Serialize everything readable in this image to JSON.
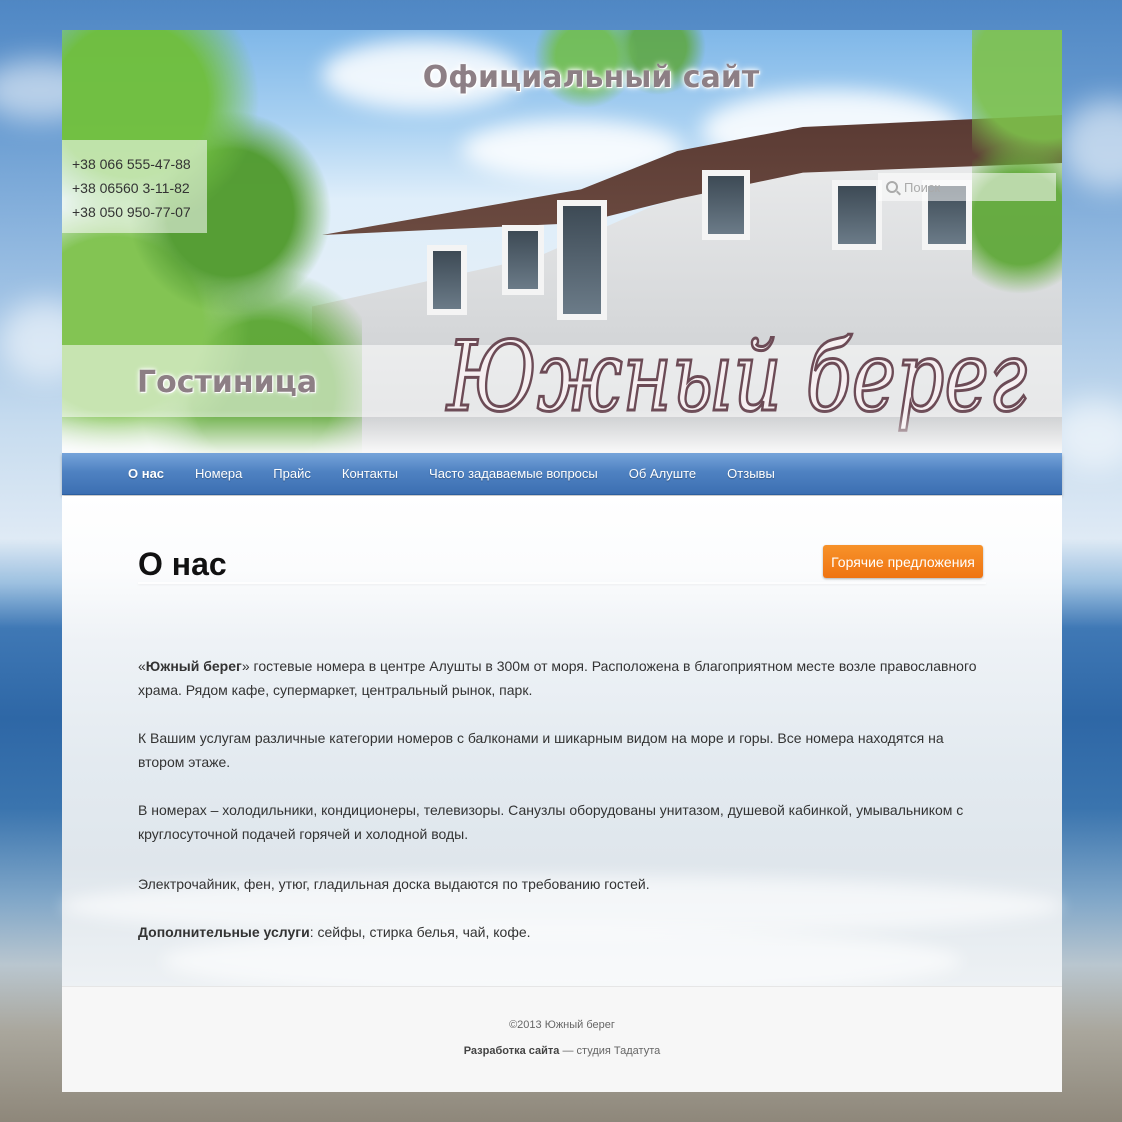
{
  "header": {
    "official_title": "Официальный сайт",
    "hotel_label": "Гостиница",
    "logo_text": "Южный берег",
    "phones": [
      "+38 066 555-47-88",
      "+38 06560 3-11-82",
      "+38 050 950-77-07"
    ],
    "search": {
      "placeholder": "Поиск"
    }
  },
  "nav": {
    "items": [
      {
        "label": "О нас",
        "active": true
      },
      {
        "label": "Номера"
      },
      {
        "label": "Прайс"
      },
      {
        "label": "Контакты"
      },
      {
        "label": "Часто задаваемые вопросы"
      },
      {
        "label": "Об Алуште"
      },
      {
        "label": "Отзывы"
      }
    ]
  },
  "main": {
    "title": "О нас",
    "hot_button": "Горячие предложения",
    "p1_open_quote": "«",
    "p1_bold": "Южный берег",
    "p1_rest": "» гостевые номера в центре Алушты в 300м от моря. Расположена в благоприятном месте возле  православного храма. Рядом кафе, супермаркет, центральный рынок, парк.",
    "p2": "К Вашим услугам  различные  категории номеров с балконами и шикарным видом на море и горы. Все номера находятся на втором этаже.",
    "p3": "В номерах – холодильники, кондиционеры, телевизоры. Санузлы оборудованы унитазом, душевой кабинкой, умывальником  с круглосуточной подачей горячей и холодной воды.",
    "p4": "Электрочайник, фен, утюг, гладильная доска выдаются по требованию гостей.",
    "p5_bold": "Дополнительные услуги",
    "p5_rest": ": сейфы, стирка белья, чай, кофе."
  },
  "footer": {
    "copyright": "©2013 Южный берег",
    "dev_bold": "Разработка сайта",
    "dev_rest": " — студия Тадатута"
  },
  "colors": {
    "nav_blue": "#4f82c2",
    "accent_orange": "#f07a18",
    "title_gray": "#8d7f85"
  }
}
